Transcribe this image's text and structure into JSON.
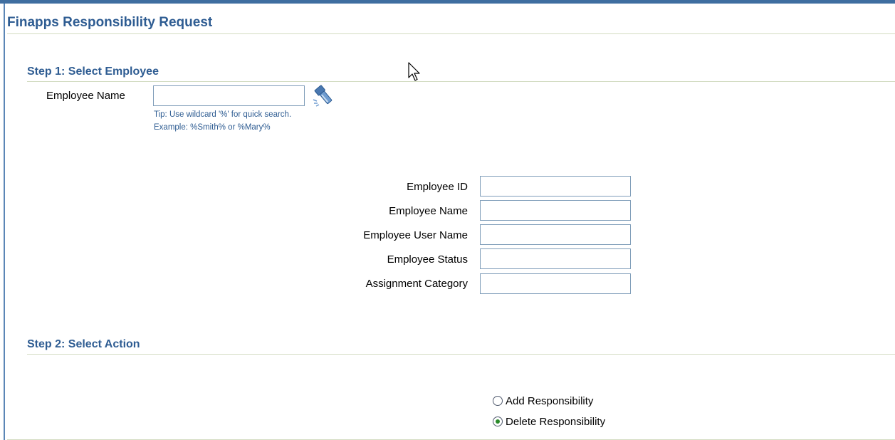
{
  "page": {
    "title": "Finapps Responsibility Request"
  },
  "step1": {
    "header": "Step 1: Select Employee",
    "employee_name_label": "Employee Name",
    "employee_name_value": "",
    "tip_line1": "Tip: Use wildcard '%' for quick search.",
    "tip_line2": "Example: %Smith% or %Mary%",
    "search_icon": "flashlight-search-icon",
    "details": [
      {
        "label": "Employee ID",
        "value": ""
      },
      {
        "label": "Employee Name",
        "value": ""
      },
      {
        "label": "Employee User Name",
        "value": ""
      },
      {
        "label": "Employee Status",
        "value": ""
      },
      {
        "label": "Assignment Category",
        "value": ""
      }
    ]
  },
  "step2": {
    "header": "Step 2: Select Action",
    "options": [
      {
        "label": "Add Responsibility",
        "selected": false
      },
      {
        "label": "Delete Responsibility",
        "selected": true
      }
    ]
  },
  "colors": {
    "accent": "#2e5c92",
    "top_bar": "#3f6ea0",
    "rule": "#d3dcc2",
    "input_border": "#7f9db9",
    "radio_selected": "#2a8a2a"
  }
}
